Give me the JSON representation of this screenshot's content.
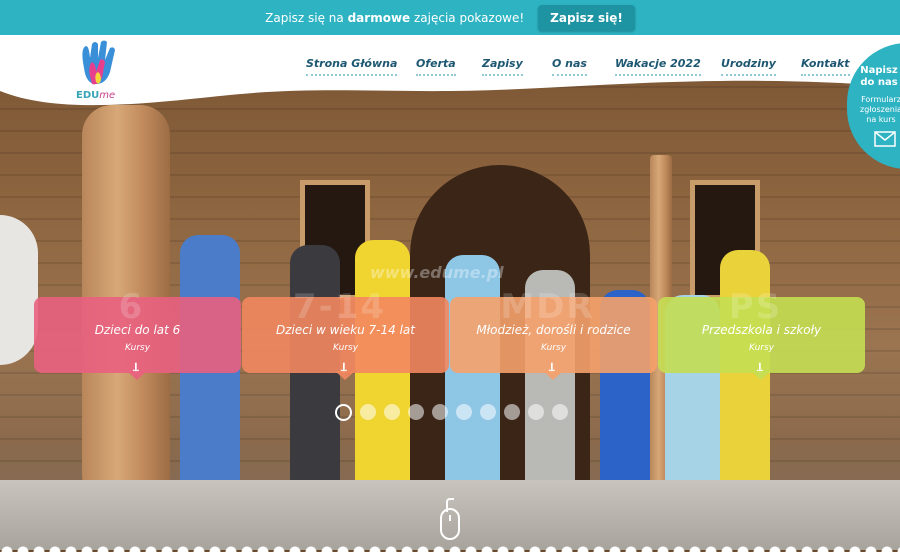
{
  "topbar": {
    "promo_prefix": "Zapisz się na",
    "promo_bold": "darmowe",
    "promo_suffix": "zajęcia pokazowe!",
    "cta_label": "Zapisz się!"
  },
  "brand": {
    "logo_main": "EDU",
    "logo_accent": "me"
  },
  "nav": {
    "items": [
      "Strona Główna",
      "Oferta",
      "Zapisy",
      "O nas",
      "Wakacje 2022",
      "Urodziny",
      "Kontakt"
    ]
  },
  "contact_tab": {
    "title": "Napisz do nas",
    "subtitle": "Formularz zgłoszenia na kurs"
  },
  "hero": {
    "watermark": "www.edume.pl",
    "cards": [
      {
        "bg_text": "6",
        "title": "Dzieci do lat 6",
        "sub": "Kursy",
        "arrow": "↓",
        "color": "#e8617f"
      },
      {
        "bg_text": "7-14",
        "title": "Dzieci w wieku 7-14 lat",
        "sub": "Kursy",
        "arrow": "↓",
        "color": "#f2875f"
      },
      {
        "bg_text": "MDR",
        "title": "Młodzież, dorośli i rodzice",
        "sub": "Kursy",
        "arrow": "↓",
        "color": "#f5a16a"
      },
      {
        "bg_text": "PS",
        "title": "Przedszkola i szkoły",
        "sub": "Kursy",
        "arrow": "↓",
        "color": "#c4de52"
      }
    ],
    "slider_count": 10,
    "slider_active": 1
  },
  "colors": {
    "accent": "#2db3c2",
    "nav_text": "#1d5772"
  }
}
